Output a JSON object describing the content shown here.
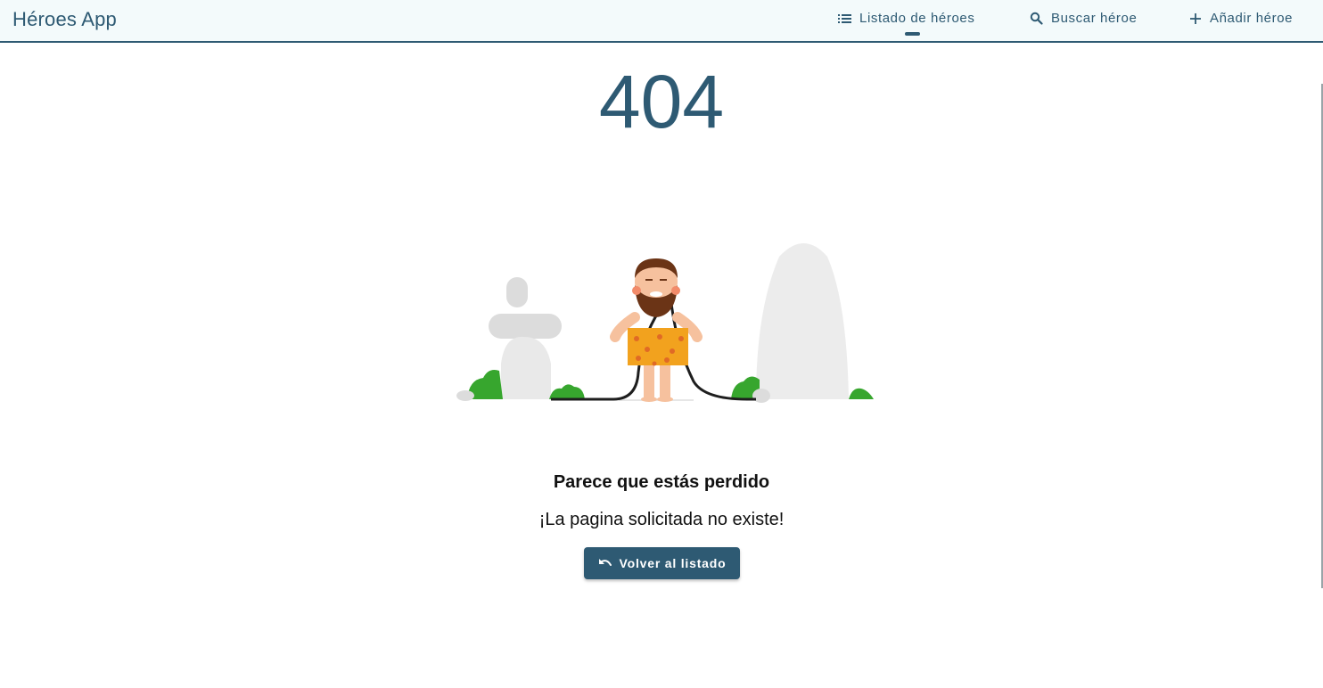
{
  "app": {
    "title": "Héroes App"
  },
  "nav": {
    "items": [
      {
        "label": "Listado de héroes",
        "icon": "list-icon",
        "active": true
      },
      {
        "label": "Buscar héroe",
        "icon": "search-icon",
        "active": false
      },
      {
        "label": "Añadir héroe",
        "icon": "add-icon",
        "active": false
      }
    ]
  },
  "error": {
    "code": "404",
    "title": "Parece que estás perdido",
    "message": "¡La pagina solicitada no existe!",
    "button_label": "Volver al listado",
    "button_icon": "undo-icon"
  },
  "colors": {
    "primary": "#2e5a73",
    "toolbar_bg": "#f3fafb"
  }
}
